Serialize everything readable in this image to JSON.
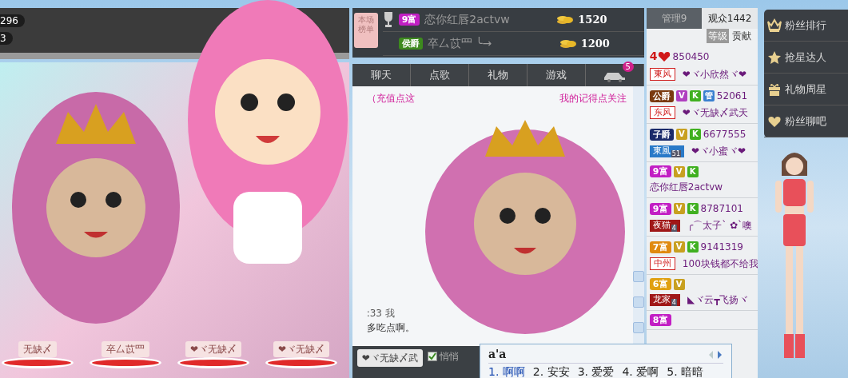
{
  "stage": {
    "counters": [
      "296",
      "3"
    ],
    "seats": [
      {
        "name": "无缺〆"
      },
      {
        "name": "卒厶苡罒"
      },
      {
        "name": "❤ヾ无缺〆"
      },
      {
        "name": "❤ヾ无缺〆"
      }
    ]
  },
  "ranking": {
    "tag": "本场榜单",
    "rows": [
      {
        "badge": {
          "text": "9富",
          "color": "#c21fc4"
        },
        "name": "恋你红唇2actvw",
        "amount": "1520"
      },
      {
        "badge": {
          "text": "侯爵",
          "color": "#3d8a1e"
        },
        "name": "卒厶苡罒 ╰→",
        "amount": "1200"
      }
    ]
  },
  "tabs": [
    {
      "kind": "text",
      "label": "聊天",
      "selected": false
    },
    {
      "kind": "text",
      "label": "点歌",
      "selected": false
    },
    {
      "kind": "text",
      "label": "礼物",
      "selected": false
    },
    {
      "kind": "text",
      "label": "游戏",
      "selected": false
    },
    {
      "kind": "car",
      "badge": "5",
      "selected": false
    }
  ],
  "chat": {
    "messages": [
      {
        "kind": "notice",
        "text": "（充值点这"
      },
      {
        "kind": "notice",
        "text": "我的记得点关注"
      },
      {
        "kind": "time",
        "text": ":33 我"
      },
      {
        "kind": "message",
        "text": "多吃点啊。"
      }
    ]
  },
  "input_bar": {
    "recipient": "❤ヾ无缺〆武",
    "whisper": {
      "label": "悄悄",
      "checked": true
    }
  },
  "ime": {
    "composition": "a'a",
    "candidates": [
      {
        "number": "1.",
        "text": "啊啊",
        "selected": true
      },
      {
        "number": "2.",
        "text": "安安",
        "selected": false
      },
      {
        "number": "3.",
        "text": "爱爱",
        "selected": false
      },
      {
        "number": "4.",
        "text": "爱啊",
        "selected": false
      },
      {
        "number": "5.",
        "text": "暗暗",
        "selected": false
      }
    ]
  },
  "audience": {
    "tabs": [
      {
        "label": "管理9",
        "selected": false
      },
      {
        "label": "观众1442",
        "selected": true
      }
    ],
    "sort": [
      {
        "label": "等级",
        "selected": true
      },
      {
        "label": "贡献",
        "selected": false
      }
    ],
    "users": [
      {
        "rank": {
          "kind": "heart",
          "text": "4"
        },
        "id": "850450",
        "city": {
          "text": "東风",
          "kind": "outline",
          "color": "#d02020"
        },
        "name": "❤ヾ小欣然ヾ❤"
      },
      {
        "rank": {
          "kind": "title",
          "text": "公爵",
          "color": "#7a3a10"
        },
        "marks": [
          {
            "text": "V",
            "color": "#b040c0"
          },
          {
            "text": "K",
            "color": "#40b020"
          },
          {
            "text": "管",
            "color": "#3a80d0"
          }
        ],
        "id": "52061",
        "city": {
          "text": "东风",
          "kind": "outline",
          "color": "#d02020"
        },
        "name": "❤ヾ无缺〆武天"
      },
      {
        "rank": {
          "kind": "title",
          "text": "子爵",
          "color": "#1a2a6a"
        },
        "marks": [
          {
            "text": "V",
            "color": "#c8a020"
          },
          {
            "text": "K",
            "color": "#40b020"
          }
        ],
        "id": "6677555",
        "city": {
          "text": "東風",
          "kind": "filled",
          "color": "#2a7ac8",
          "sub": "51"
        },
        "name": "❤ヾ小蜜ヾ❤"
      },
      {
        "rank": {
          "kind": "title",
          "text": "9富",
          "color": "#c21fc4"
        },
        "marks": [
          {
            "text": "V",
            "color": "#c8a020"
          },
          {
            "text": "K",
            "color": "#40b020"
          }
        ],
        "name": "恋你红唇2actvw"
      },
      {
        "rank": {
          "kind": "title",
          "text": "9富",
          "color": "#c21fc4"
        },
        "marks": [
          {
            "text": "V",
            "color": "#c8a020"
          },
          {
            "text": "K",
            "color": "#40b020"
          }
        ],
        "id": "8787101",
        "city": {
          "text": "夜猫",
          "kind": "filled",
          "color": "#a01818",
          "sub": "4"
        },
        "name": "╭⌒太子` ✿`噢"
      },
      {
        "rank": {
          "kind": "title",
          "text": "7富",
          "color": "#e08a10"
        },
        "marks": [
          {
            "text": "V",
            "color": "#c8a020"
          },
          {
            "text": "K",
            "color": "#40b020"
          }
        ],
        "id": "9141319",
        "city": {
          "text": "中州",
          "kind": "outline",
          "color": "#d02020"
        },
        "name": "100块钱都不给我"
      },
      {
        "rank": {
          "kind": "title",
          "text": "6富",
          "color": "#e0a010"
        },
        "marks": [
          {
            "text": "V",
            "color": "#c8a020"
          }
        ],
        "city": {
          "text": "龙家",
          "kind": "filled",
          "color": "#a01818",
          "sub": "4"
        },
        "name": "◣ヾ云┳飞扬ヾ"
      },
      {
        "rank": {
          "kind": "title",
          "text": "8富",
          "color": "#c21fc4"
        }
      }
    ]
  },
  "sidebar": {
    "items": [
      {
        "label": "粉丝排行"
      },
      {
        "label": "抢星达人"
      },
      {
        "label": "礼物周星"
      },
      {
        "label": "粉丝聊吧"
      }
    ]
  }
}
